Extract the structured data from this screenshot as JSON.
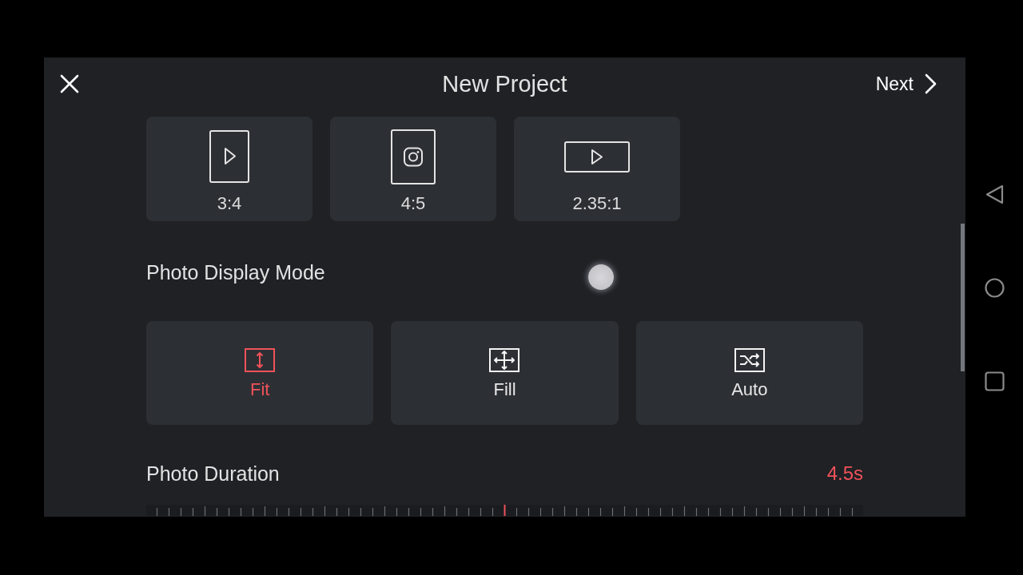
{
  "header": {
    "title": "New Project",
    "next": "Next"
  },
  "aspect_ratios": [
    {
      "label": "3:4",
      "kind": "portrait-play"
    },
    {
      "label": "4:5",
      "kind": "portrait-camera"
    },
    {
      "label": "2.35:1",
      "kind": "wide-play"
    }
  ],
  "display_mode": {
    "title": "Photo Display Mode",
    "options": [
      {
        "label": "Fit",
        "kind": "fit",
        "selected": true
      },
      {
        "label": "Fill",
        "kind": "fill",
        "selected": false
      },
      {
        "label": "Auto",
        "kind": "auto",
        "selected": false
      }
    ]
  },
  "duration": {
    "title": "Photo Duration",
    "value": "4.5s"
  }
}
